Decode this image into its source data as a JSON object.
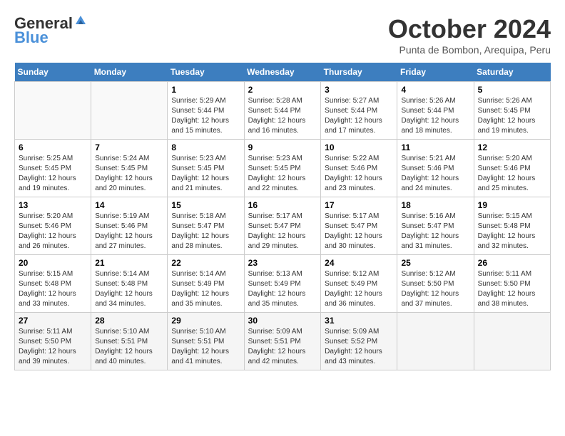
{
  "header": {
    "logo_line1": "General",
    "logo_line2": "Blue",
    "month_title": "October 2024",
    "location": "Punta de Bombon, Arequipa, Peru"
  },
  "days_of_week": [
    "Sunday",
    "Monday",
    "Tuesday",
    "Wednesday",
    "Thursday",
    "Friday",
    "Saturday"
  ],
  "weeks": [
    [
      {
        "day": "",
        "sunrise": "",
        "sunset": "",
        "daylight": ""
      },
      {
        "day": "",
        "sunrise": "",
        "sunset": "",
        "daylight": ""
      },
      {
        "day": "1",
        "sunrise": "Sunrise: 5:29 AM",
        "sunset": "Sunset: 5:44 PM",
        "daylight": "Daylight: 12 hours and 15 minutes."
      },
      {
        "day": "2",
        "sunrise": "Sunrise: 5:28 AM",
        "sunset": "Sunset: 5:44 PM",
        "daylight": "Daylight: 12 hours and 16 minutes."
      },
      {
        "day": "3",
        "sunrise": "Sunrise: 5:27 AM",
        "sunset": "Sunset: 5:44 PM",
        "daylight": "Daylight: 12 hours and 17 minutes."
      },
      {
        "day": "4",
        "sunrise": "Sunrise: 5:26 AM",
        "sunset": "Sunset: 5:44 PM",
        "daylight": "Daylight: 12 hours and 18 minutes."
      },
      {
        "day": "5",
        "sunrise": "Sunrise: 5:26 AM",
        "sunset": "Sunset: 5:45 PM",
        "daylight": "Daylight: 12 hours and 19 minutes."
      }
    ],
    [
      {
        "day": "6",
        "sunrise": "Sunrise: 5:25 AM",
        "sunset": "Sunset: 5:45 PM",
        "daylight": "Daylight: 12 hours and 19 minutes."
      },
      {
        "day": "7",
        "sunrise": "Sunrise: 5:24 AM",
        "sunset": "Sunset: 5:45 PM",
        "daylight": "Daylight: 12 hours and 20 minutes."
      },
      {
        "day": "8",
        "sunrise": "Sunrise: 5:23 AM",
        "sunset": "Sunset: 5:45 PM",
        "daylight": "Daylight: 12 hours and 21 minutes."
      },
      {
        "day": "9",
        "sunrise": "Sunrise: 5:23 AM",
        "sunset": "Sunset: 5:45 PM",
        "daylight": "Daylight: 12 hours and 22 minutes."
      },
      {
        "day": "10",
        "sunrise": "Sunrise: 5:22 AM",
        "sunset": "Sunset: 5:46 PM",
        "daylight": "Daylight: 12 hours and 23 minutes."
      },
      {
        "day": "11",
        "sunrise": "Sunrise: 5:21 AM",
        "sunset": "Sunset: 5:46 PM",
        "daylight": "Daylight: 12 hours and 24 minutes."
      },
      {
        "day": "12",
        "sunrise": "Sunrise: 5:20 AM",
        "sunset": "Sunset: 5:46 PM",
        "daylight": "Daylight: 12 hours and 25 minutes."
      }
    ],
    [
      {
        "day": "13",
        "sunrise": "Sunrise: 5:20 AM",
        "sunset": "Sunset: 5:46 PM",
        "daylight": "Daylight: 12 hours and 26 minutes."
      },
      {
        "day": "14",
        "sunrise": "Sunrise: 5:19 AM",
        "sunset": "Sunset: 5:46 PM",
        "daylight": "Daylight: 12 hours and 27 minutes."
      },
      {
        "day": "15",
        "sunrise": "Sunrise: 5:18 AM",
        "sunset": "Sunset: 5:47 PM",
        "daylight": "Daylight: 12 hours and 28 minutes."
      },
      {
        "day": "16",
        "sunrise": "Sunrise: 5:17 AM",
        "sunset": "Sunset: 5:47 PM",
        "daylight": "Daylight: 12 hours and 29 minutes."
      },
      {
        "day": "17",
        "sunrise": "Sunrise: 5:17 AM",
        "sunset": "Sunset: 5:47 PM",
        "daylight": "Daylight: 12 hours and 30 minutes."
      },
      {
        "day": "18",
        "sunrise": "Sunrise: 5:16 AM",
        "sunset": "Sunset: 5:47 PM",
        "daylight": "Daylight: 12 hours and 31 minutes."
      },
      {
        "day": "19",
        "sunrise": "Sunrise: 5:15 AM",
        "sunset": "Sunset: 5:48 PM",
        "daylight": "Daylight: 12 hours and 32 minutes."
      }
    ],
    [
      {
        "day": "20",
        "sunrise": "Sunrise: 5:15 AM",
        "sunset": "Sunset: 5:48 PM",
        "daylight": "Daylight: 12 hours and 33 minutes."
      },
      {
        "day": "21",
        "sunrise": "Sunrise: 5:14 AM",
        "sunset": "Sunset: 5:48 PM",
        "daylight": "Daylight: 12 hours and 34 minutes."
      },
      {
        "day": "22",
        "sunrise": "Sunrise: 5:14 AM",
        "sunset": "Sunset: 5:49 PM",
        "daylight": "Daylight: 12 hours and 35 minutes."
      },
      {
        "day": "23",
        "sunrise": "Sunrise: 5:13 AM",
        "sunset": "Sunset: 5:49 PM",
        "daylight": "Daylight: 12 hours and 35 minutes."
      },
      {
        "day": "24",
        "sunrise": "Sunrise: 5:12 AM",
        "sunset": "Sunset: 5:49 PM",
        "daylight": "Daylight: 12 hours and 36 minutes."
      },
      {
        "day": "25",
        "sunrise": "Sunrise: 5:12 AM",
        "sunset": "Sunset: 5:50 PM",
        "daylight": "Daylight: 12 hours and 37 minutes."
      },
      {
        "day": "26",
        "sunrise": "Sunrise: 5:11 AM",
        "sunset": "Sunset: 5:50 PM",
        "daylight": "Daylight: 12 hours and 38 minutes."
      }
    ],
    [
      {
        "day": "27",
        "sunrise": "Sunrise: 5:11 AM",
        "sunset": "Sunset: 5:50 PM",
        "daylight": "Daylight: 12 hours and 39 minutes."
      },
      {
        "day": "28",
        "sunrise": "Sunrise: 5:10 AM",
        "sunset": "Sunset: 5:51 PM",
        "daylight": "Daylight: 12 hours and 40 minutes."
      },
      {
        "day": "29",
        "sunrise": "Sunrise: 5:10 AM",
        "sunset": "Sunset: 5:51 PM",
        "daylight": "Daylight: 12 hours and 41 minutes."
      },
      {
        "day": "30",
        "sunrise": "Sunrise: 5:09 AM",
        "sunset": "Sunset: 5:51 PM",
        "daylight": "Daylight: 12 hours and 42 minutes."
      },
      {
        "day": "31",
        "sunrise": "Sunrise: 5:09 AM",
        "sunset": "Sunset: 5:52 PM",
        "daylight": "Daylight: 12 hours and 43 minutes."
      },
      {
        "day": "",
        "sunrise": "",
        "sunset": "",
        "daylight": ""
      },
      {
        "day": "",
        "sunrise": "",
        "sunset": "",
        "daylight": ""
      }
    ]
  ]
}
